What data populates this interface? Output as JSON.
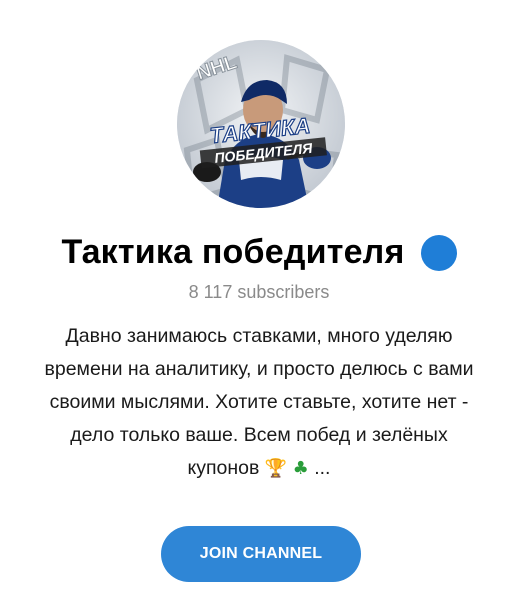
{
  "channel": {
    "title": "Тактика победителя",
    "subscribers": "8 117 subscribers",
    "description_lines": [
      "Давно занимаюсь ставками, много уделяю",
      "времени на аналитику, и просто делюсь с вами",
      "своими мыслями. Хотите ставьте, хотите нет -",
      "дело только ваше. Всем побед и зелёных",
      "купонов"
    ],
    "description_tail_emoji": [
      "trophy-icon",
      "four-leaf-clover-icon"
    ],
    "description_ellipsis": "...",
    "avatar_text_top": "ТАКТИКА",
    "avatar_text_bottom": "ПОБЕДИТЕЛЯ",
    "avatar_logo_text": "NHL",
    "verified": true
  },
  "actions": {
    "join_label": "JOIN CHANNEL"
  },
  "colors": {
    "accent": "#2f86d6",
    "verified_badge": "#1f7ed7",
    "subscribers_text": "#8a8a8a"
  }
}
